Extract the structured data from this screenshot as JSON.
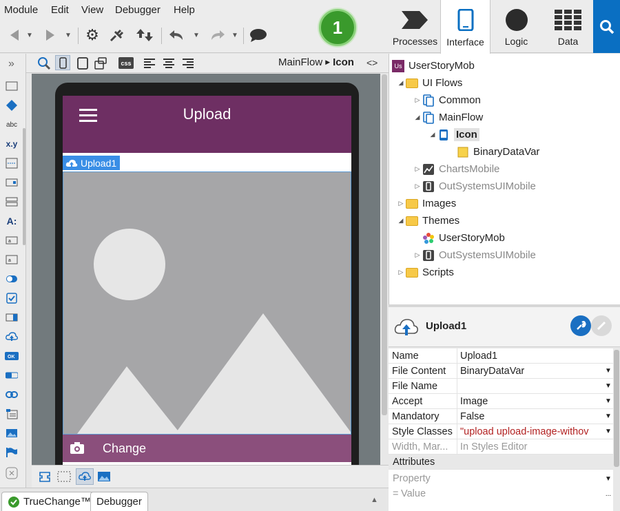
{
  "menu": [
    "Module",
    "Edit",
    "View",
    "Debugger",
    "Help"
  ],
  "badge_count": "1",
  "tabs": [
    {
      "label": "Processes",
      "icon": "processes-icon"
    },
    {
      "label": "Interface",
      "icon": "phone-icon"
    },
    {
      "label": "Logic",
      "icon": "logic-icon"
    },
    {
      "label": "Data",
      "icon": "data-grid-icon"
    }
  ],
  "canvas": {
    "breadcrumb_flow": "MainFlow",
    "breadcrumb_screen": "Icon",
    "css_label": "css",
    "code_toggle": "<>",
    "app_title": "Upload",
    "widget_tag": "Upload1",
    "change_label": "Change"
  },
  "toolbox": {
    "expand": "»",
    "text_tool": "abc",
    "expr_tool": "x.y",
    "label_tool": "A:",
    "ok_tool": "OK"
  },
  "tree": [
    {
      "label": "UserStoryMob",
      "level": 0,
      "icon": "module-icon",
      "tri": "",
      "muted": false,
      "bold": false
    },
    {
      "label": "UI Flows",
      "level": 1,
      "icon": "folder-open-icon",
      "tri": "◢",
      "muted": false,
      "bold": false
    },
    {
      "label": "Common",
      "level": 2,
      "icon": "flow-icon",
      "tri": "▷",
      "muted": false,
      "bold": false
    },
    {
      "label": "MainFlow",
      "level": 2,
      "icon": "flow-icon",
      "tri": "◢",
      "muted": false,
      "bold": false
    },
    {
      "label": "Icon",
      "level": 3,
      "icon": "screen-icon",
      "tri": "◢",
      "muted": false,
      "bold": true
    },
    {
      "label": "BinaryDataVar",
      "level": 4,
      "icon": "variable-icon",
      "tri": "",
      "muted": false,
      "bold": false
    },
    {
      "label": "ChartsMobile",
      "level": 2,
      "icon": "chart-icon",
      "tri": "▷",
      "muted": true,
      "bold": false
    },
    {
      "label": "OutSystemsUIMobile",
      "level": 2,
      "icon": "device-icon",
      "tri": "▷",
      "muted": true,
      "bold": false
    },
    {
      "label": "Images",
      "level": 1,
      "icon": "folder-icon",
      "tri": "▷",
      "muted": false,
      "bold": false
    },
    {
      "label": "Themes",
      "level": 1,
      "icon": "folder-open-icon",
      "tri": "◢",
      "muted": false,
      "bold": false
    },
    {
      "label": "UserStoryMob",
      "level": 2,
      "icon": "theme-icon",
      "tri": "",
      "muted": false,
      "bold": false
    },
    {
      "label": "OutSystemsUIMobile",
      "level": 2,
      "icon": "device-icon",
      "tri": "▷",
      "muted": true,
      "bold": false
    },
    {
      "label": "Scripts",
      "level": 1,
      "icon": "folder-icon",
      "tri": "▷",
      "muted": false,
      "bold": false
    }
  ],
  "properties": {
    "widget_name": "Upload1",
    "rows": [
      {
        "key": "Name",
        "value": "Upload1",
        "dropdown": false,
        "muted": false,
        "red": false
      },
      {
        "key": "File Content",
        "value": "BinaryDataVar",
        "dropdown": true,
        "muted": false,
        "red": false
      },
      {
        "key": "File Name",
        "value": "",
        "dropdown": true,
        "muted": false,
        "red": false
      },
      {
        "key": "Accept",
        "value": "Image",
        "dropdown": true,
        "muted": false,
        "red": false
      },
      {
        "key": "Mandatory",
        "value": "False",
        "dropdown": true,
        "muted": false,
        "red": false
      },
      {
        "key": "Style Classes",
        "value": "\"upload upload-image-withov",
        "dropdown": true,
        "muted": false,
        "red": true
      },
      {
        "key": "Width, Mar...",
        "value": "In Styles Editor",
        "dropdown": false,
        "muted": true,
        "red": false
      }
    ],
    "attributes_header": "Attributes",
    "attr_property_placeholder": "Property",
    "attr_value_placeholder": "Value",
    "attr_value_prefix": "=",
    "attr_more": "..."
  },
  "bottom_tabs": [
    "TrueChange™",
    "Debugger"
  ],
  "bottom_arrow": "▲",
  "colors": {
    "app_header": "#6e2f63",
    "change_bar": "#8b4f7c",
    "accent": "#0a6fc2",
    "badge": "#3a9a2c"
  }
}
